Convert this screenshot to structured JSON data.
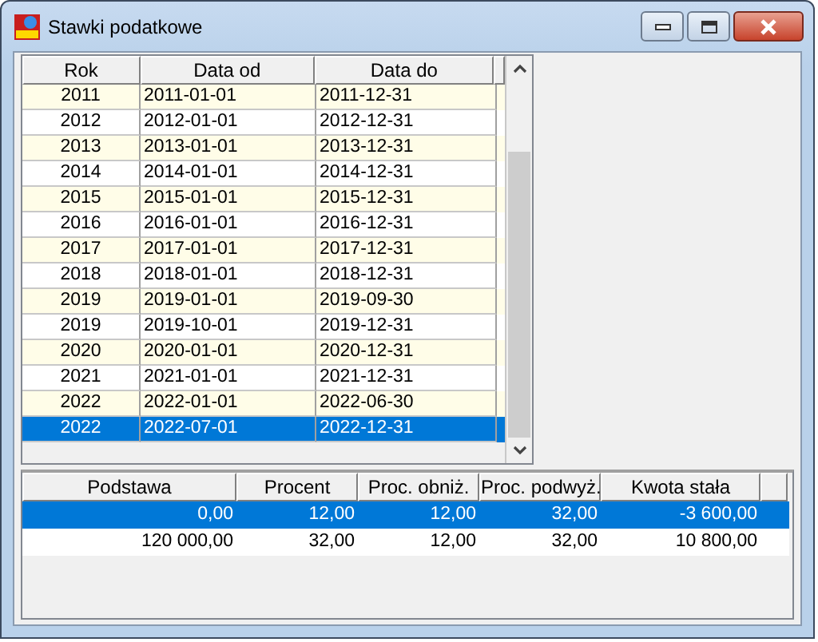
{
  "window": {
    "title": "Stawki podatkowe"
  },
  "periods": {
    "columns": [
      "Rok",
      "Data od",
      "Data do"
    ],
    "rows": [
      {
        "cells": [
          "2011",
          "2011-01-01",
          "2011-12-31"
        ],
        "selected": false
      },
      {
        "cells": [
          "2012",
          "2012-01-01",
          "2012-12-31"
        ],
        "selected": false
      },
      {
        "cells": [
          "2013",
          "2013-01-01",
          "2013-12-31"
        ],
        "selected": false
      },
      {
        "cells": [
          "2014",
          "2014-01-01",
          "2014-12-31"
        ],
        "selected": false
      },
      {
        "cells": [
          "2015",
          "2015-01-01",
          "2015-12-31"
        ],
        "selected": false
      },
      {
        "cells": [
          "2016",
          "2016-01-01",
          "2016-12-31"
        ],
        "selected": false
      },
      {
        "cells": [
          "2017",
          "2017-01-01",
          "2017-12-31"
        ],
        "selected": false
      },
      {
        "cells": [
          "2018",
          "2018-01-01",
          "2018-12-31"
        ],
        "selected": false
      },
      {
        "cells": [
          "2019",
          "2019-01-01",
          "2019-09-30"
        ],
        "selected": false
      },
      {
        "cells": [
          "2019",
          "2019-10-01",
          "2019-12-31"
        ],
        "selected": false
      },
      {
        "cells": [
          "2020",
          "2020-01-01",
          "2020-12-31"
        ],
        "selected": false
      },
      {
        "cells": [
          "2021",
          "2021-01-01",
          "2021-12-31"
        ],
        "selected": false
      },
      {
        "cells": [
          "2022",
          "2022-01-01",
          "2022-06-30"
        ],
        "selected": false
      },
      {
        "cells": [
          "2022",
          "2022-07-01",
          "2022-12-31"
        ],
        "selected": true
      }
    ]
  },
  "rates": {
    "columns": [
      "Podstawa",
      "Procent",
      "Proc. obniż.",
      "Proc. podwyż.",
      "Kwota stała"
    ],
    "rows": [
      {
        "cells": [
          "0,00",
          "12,00",
          "12,00",
          "32,00",
          "-3 600,00"
        ],
        "selected": true
      },
      {
        "cells": [
          "120 000,00",
          "32,00",
          "12,00",
          "32,00",
          "10 800,00"
        ],
        "selected": false
      }
    ]
  }
}
